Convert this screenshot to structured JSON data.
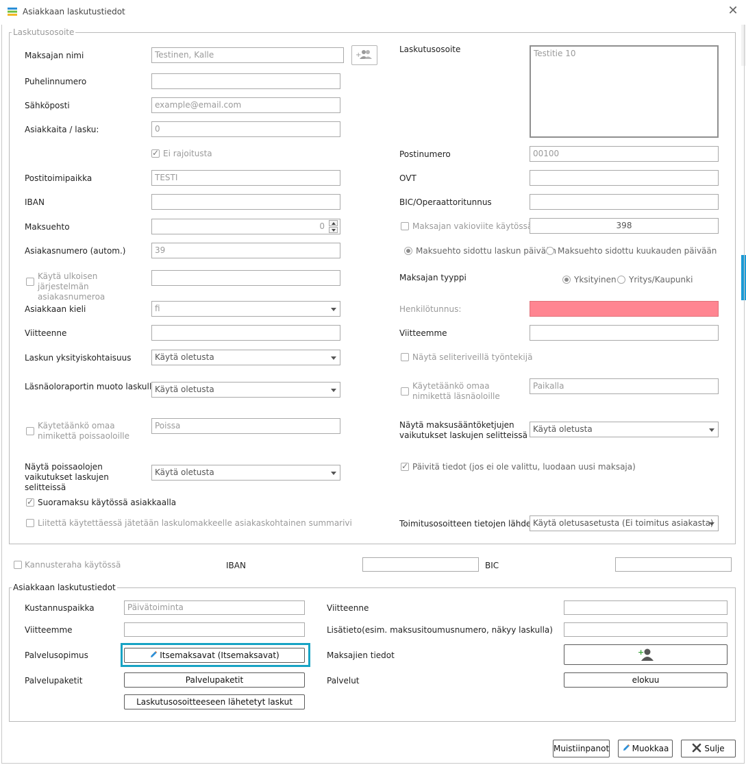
{
  "window": {
    "title": "Asiakkaan laskutustiedot"
  },
  "billing_address_section": {
    "legend": "Laskutusosoite",
    "payer_name_label": "Maksajan nimi",
    "payer_name_value": "Testinen, Kalle",
    "phone_label": "Puhelinnumero",
    "phone_value": "",
    "email_label": "Sähköposti",
    "email_placeholder": "example@email.com",
    "customers_per_invoice_label": "Asiakkaita / lasku:",
    "customers_per_invoice_value": "0",
    "no_limit_label": "Ei rajoitusta",
    "city_label": "Postitoimipaikka",
    "city_value": "TESTI",
    "iban_label": "IBAN",
    "iban_value": "",
    "payment_term_label": "Maksuehto",
    "payment_term_value": "0",
    "customer_number_label": "Asiakasnumero (autom.)",
    "customer_number_value": "39",
    "external_number_label": "Käytä ulkoisen järjestelmän asiakasnumeroa",
    "external_number_value": "",
    "language_label": "Asiakkaan kieli",
    "language_value": "fi",
    "our_ref_label": "Viitteenne",
    "our_ref_value": "",
    "invoice_detail_label": "Laskun yksityiskohtaisuus",
    "invoice_detail_value": "Käytä oletusta",
    "attendance_format_label": "Läsnäoloraportin muoto laskulla",
    "attendance_format_value": "Käytä oletusta",
    "own_absence_name_label": "Käytetäänkö omaa nimikettä poissaoloille",
    "own_absence_name_value": "Poissa",
    "show_absence_effects_label": "Näytä poissaolojen vaikutukset laskujen selitteissä",
    "show_absence_effects_value": "Käytä oletusta",
    "direct_debit_label": "Suoramaksu käytössä asiakkaalla",
    "attachment_summary_label": "Liitettä käytettäessä jätetään laskulomakkeelle asiakaskohtainen summarivi",
    "billing_address_label": "Laskutusosoite",
    "billing_address_value": "Testitie 10",
    "postal_code_label": "Postinumero",
    "postal_code_value": "00100",
    "ovt_label": "OVT",
    "ovt_value": "",
    "bic_operator_label": "BIC/Operaattoritunnus",
    "bic_operator_value": "",
    "default_ref_label": "Maksajan vakioviite käytössä",
    "default_ref_value": "398",
    "term_invoice_date_label": "Maksuehto sidottu laskun päivään",
    "term_month_day_label": "Maksuehto sidottu kuukauden päivään",
    "payer_type_label": "Maksajan tyyppi",
    "private_label": "Yksityinen",
    "company_label": "Yritys/Kaupunki",
    "ssn_label": "Henkilötunnus:",
    "ssn_value": "",
    "your_ref_label": "Viitteemme",
    "your_ref_value": "",
    "show_employee_label": "Näytä seliteriveillä työntekijä",
    "own_presence_name_label": "Käytetäänkö omaa nimikettä läsnäoloille",
    "own_presence_name_value": "Paikalla",
    "show_rule_effects_label": "Näytä maksusääntöketjujen vaikutukset laskujen selitteissä",
    "show_rule_effects_value": "Käytä oletusta",
    "update_info_label": "Päivitä tiedot (jos ei ole valittu, luodaan uusi maksaja)",
    "delivery_source_label": "Toimitusosoitteen tietojen lähde",
    "delivery_source_value": "Käytä oletusasetusta (Ei toimitus asiakasta)"
  },
  "incentive": {
    "enabled_label": "Kannusteraha käytössä",
    "iban_label": "IBAN",
    "iban_value": "",
    "bic_label": "BIC",
    "bic_value": ""
  },
  "customer_billing_section": {
    "legend": "Asiakkaan laskutustiedot",
    "cost_center_label": "Kustannuspaikka",
    "cost_center_value": "Päivätoiminta",
    "our_ref_label": "Viitteenne",
    "our_ref_value": "",
    "your_ref_label": "Viitteemme",
    "your_ref_value": "",
    "extra_info_label": "Lisätieto(esim. maksusitoumusnumero, näkyy laskulla)",
    "extra_info_value": "",
    "service_contract_label": "Palvelusopimus",
    "service_contract_button": "Itsemaksavat (Itsemaksavat)",
    "payer_info_label": "Maksajien tiedot",
    "service_packages_label": "Palvelupaketit",
    "service_packages_button": "Palvelupaketit",
    "services_label": "Palvelut",
    "services_button": "elokuu",
    "sent_invoices_button": "Laskutusosoitteeseen lähetetyt laskut"
  },
  "footer": {
    "notes_button": "Muistiinpanot",
    "edit_button": "Muokkaa",
    "close_button": "Sulje"
  },
  "colors": {
    "highlight": "#17a3c4",
    "ssn_invalid": "#ff8591"
  }
}
